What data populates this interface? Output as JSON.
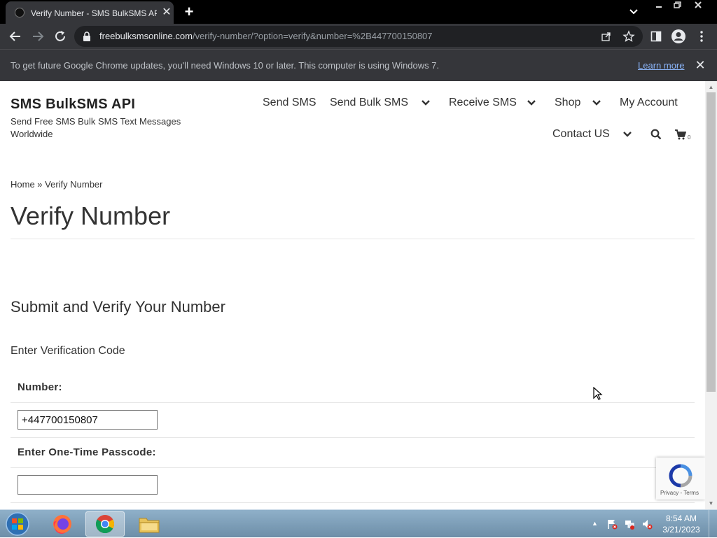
{
  "browser": {
    "tab_title": "Verify Number - SMS BulkSMS API",
    "tab_close": "✕",
    "new_tab": "+",
    "url_host": "freebulksmsonline.com",
    "url_path": "/verify-number/?option=verify&number=%2B447700150807",
    "infobar_text": "To get future Google Chrome updates, you'll need Windows 10 or later. This computer is using Windows 7.",
    "infobar_link": "Learn more",
    "infobar_close": "✕"
  },
  "site": {
    "title": "SMS BulkSMS API",
    "tagline": "Send Free SMS Bulk SMS Text Messages Worldwide",
    "nav": {
      "send_sms": "Send SMS",
      "send_bulk_sms": "Send Bulk SMS",
      "receive_sms": "Receive SMS",
      "shop": "Shop",
      "my_account": "My Account",
      "contact_us": "Contact US",
      "cart_count": "0"
    }
  },
  "page": {
    "breadcrumb": "Home » Verify Number",
    "title": "Verify Number",
    "section_heading": "Submit and Verify Your Number",
    "instruction": "Enter Verification Code",
    "number_label": "Number:",
    "number_value": "+447700150807",
    "otp_label": "Enter One-Time Passcode:",
    "otp_value": ""
  },
  "recaptcha": {
    "links": "Privacy - Terms"
  },
  "taskbar": {
    "time": "8:54 AM",
    "date": "3/21/2023"
  }
}
